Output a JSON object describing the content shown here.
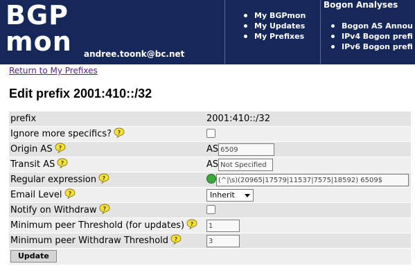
{
  "header": {
    "logo_line1": "BGP",
    "logo_line2": "mon",
    "user_email": "andree.toonk@bc.net",
    "nav": [
      {
        "label": "My BGPmon"
      },
      {
        "label": "My Updates"
      },
      {
        "label": "My Prefixes"
      }
    ],
    "bogon_title": "Bogon Analyses",
    "bogon_nav": [
      {
        "label": "Bogon AS Annou"
      },
      {
        "label": "IPv4 Bogon prefi"
      },
      {
        "label": "IPv6 Bogon prefi"
      }
    ],
    "colors": {
      "header_bg": "#16275a"
    }
  },
  "back_link": "Return to My Prefixes",
  "page_title": "Edit prefix 2001:410::/32",
  "form": {
    "prefix": {
      "label": "prefix",
      "value": "2001:410::/32"
    },
    "ignore_more_specifics": {
      "label": "Ignore more specifics?",
      "checked": false
    },
    "origin_as": {
      "label": "Origin AS",
      "prefix": "AS",
      "value": "6509"
    },
    "transit_as": {
      "label": "Transit AS",
      "prefix": "AS",
      "value": "Not Specified"
    },
    "regex": {
      "label": "Regular expression",
      "value": "(^|\\s)(20965|17579|11537|7575|18592) 6509$"
    },
    "email_level": {
      "label": "Email Level",
      "selected": "Inherit"
    },
    "notify_withdraw": {
      "label": "Notify on Withdraw",
      "checked": false
    },
    "min_peer_threshold": {
      "label": "Minimum peer Threshold (for updates)",
      "value": "1"
    },
    "min_peer_withdraw": {
      "label": "Minimum peer Withdraw Threshold",
      "value": "3"
    },
    "submit_label": "Update"
  }
}
